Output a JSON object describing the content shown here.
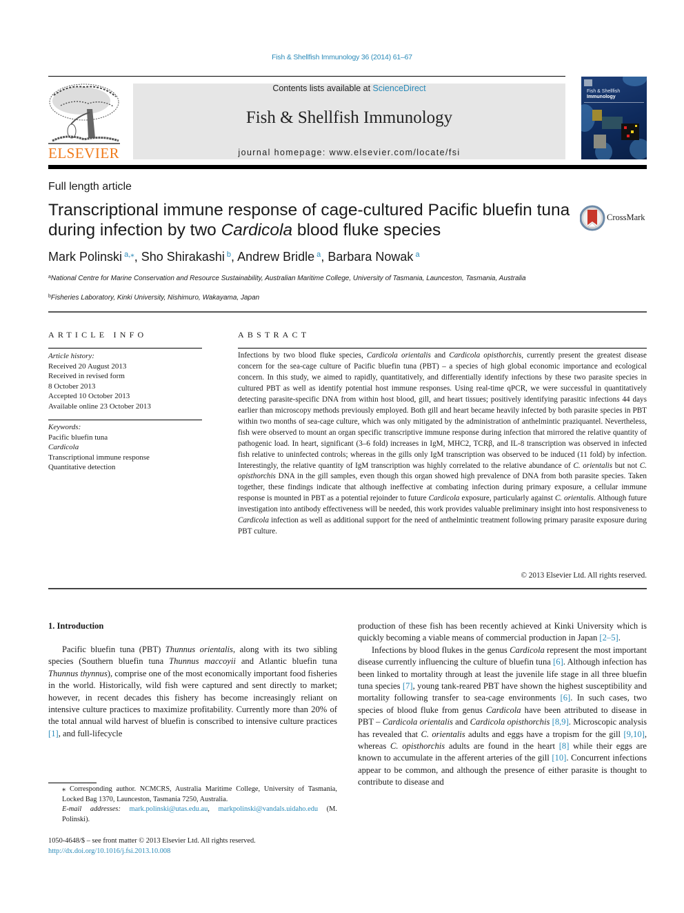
{
  "running_head": "Fish & Shellfish Immunology 36 (2014) 61–67",
  "header": {
    "publisher_logo_text": "ELSEVIER",
    "contents_prefix": "Contents lists available at ",
    "contents_link": "ScienceDirect",
    "journal_title": "Fish & Shellfish Immunology",
    "homepage": "journal homepage: www.elsevier.com/locate/fsi",
    "cover_title_line1": "Fish & Shellfish",
    "cover_title_line2": "Immunology"
  },
  "article": {
    "type": "Full length article",
    "title_part1": "Transcriptional immune response of cage-cultured Pacific bluefin tuna during infection by two ",
    "title_italic": "Cardicola",
    "title_part2": " blood fluke species",
    "crossmark_label": "CrossMark",
    "authors": [
      {
        "name": "Mark Polinski",
        "sup": "a,⁎"
      },
      {
        "name": "Sho Shirakashi",
        "sup": "b"
      },
      {
        "name": "Andrew Bridle",
        "sup": "a"
      },
      {
        "name": "Barbara Nowak",
        "sup": "a"
      }
    ],
    "affiliations": [
      {
        "label": "a",
        "text": "National Centre for Marine Conservation and Resource Sustainability, Australian Maritime College, University of Tasmania, Launceston, Tasmania, Australia"
      },
      {
        "label": "b",
        "text": "Fisheries Laboratory, Kinki University, Nishimuro, Wakayama, Japan"
      }
    ]
  },
  "article_info": {
    "heading": "ARTICLE INFO",
    "history_label": "Article history:",
    "history": [
      "Received 20 August 2013",
      "Received in revised form",
      "8 October 2013",
      "Accepted 10 October 2013",
      "Available online 23 October 2013"
    ],
    "keywords_label": "Keywords:",
    "keywords": [
      "Pacific bluefin tuna",
      "Cardicola",
      "Transcriptional immune response",
      "Quantitative detection"
    ]
  },
  "abstract": {
    "heading": "ABSTRACT",
    "segments": [
      {
        "t": "Infections by two blood fluke species, "
      },
      {
        "t": "Cardicola orientalis",
        "i": true
      },
      {
        "t": " and "
      },
      {
        "t": "Cardicola opisthorchis",
        "i": true
      },
      {
        "t": ", currently present the greatest disease concern for the sea-cage culture of Pacific bluefin tuna (PBT) – a species of high global economic importance and ecological concern. In this study, we aimed to rapidly, quantitatively, and differentially identify infections by these two parasite species in cultured PBT as well as identify potential host immune responses. Using real-time qPCR, we were successful in quantitatively detecting parasite-specific DNA from within host blood, gill, and heart tissues; positively identifying parasitic infections 44 days earlier than microscopy methods previously employed. Both gill and heart became heavily infected by both parasite species in PBT within two months of sea-cage culture, which was only mitigated by the administration of anthelmintic praziquantel. Nevertheless, fish were observed to mount an organ specific transcriptive immune response during infection that mirrored the relative quantity of pathogenic load. In heart, significant (3–6 fold) increases in IgM, MHC2, TCRβ, and IL-8 transcription was observed in infected fish relative to uninfected controls; whereas in the gills only IgM transcription was observed to be induced (11 fold) by infection. Interestingly, the relative quantity of IgM transcription was highly correlated to the relative abundance of "
      },
      {
        "t": "C. orientalis",
        "i": true
      },
      {
        "t": " but not "
      },
      {
        "t": "C. opisthorchis",
        "i": true
      },
      {
        "t": " DNA in the gill samples, even though this organ showed high prevalence of DNA from both parasite species. Taken together, these findings indicate that although ineffective at combating infection during primary exposure, a cellular immune response is mounted in PBT as a potential rejoinder to future "
      },
      {
        "t": "Cardicola",
        "i": true
      },
      {
        "t": " exposure, particularly against "
      },
      {
        "t": "C. orientalis",
        "i": true
      },
      {
        "t": ". Although future investigation into antibody effectiveness will be needed, this work provides valuable preliminary insight into host responsiveness to "
      },
      {
        "t": "Cardicola",
        "i": true
      },
      {
        "t": " infection as well as additional support for the need of anthelmintic treatment following primary parasite exposure during PBT culture."
      }
    ],
    "copyright": "© 2013 Elsevier Ltd. All rights reserved."
  },
  "introduction": {
    "heading": "1.  Introduction",
    "left_segments": [
      {
        "t": "Pacific bluefin tuna (PBT) "
      },
      {
        "t": "Thunnus orientalis",
        "i": true
      },
      {
        "t": ", along with its two sibling species (Southern bluefin tuna "
      },
      {
        "t": "Thunnus maccoyii",
        "i": true
      },
      {
        "t": " and Atlantic bluefin tuna "
      },
      {
        "t": "Thunnus thynnus",
        "i": true
      },
      {
        "t": "), comprise one of the most economically important food fisheries in the world. Historically, wild fish were captured and sent directly to market; however, in recent decades this fishery has become increasingly reliant on intensive culture practices to maximize profitability. Currently more than 20% of the total annual wild harvest of bluefin is conscribed to intensive culture practices "
      },
      {
        "t": "[1]",
        "l": true
      },
      {
        "t": ", and full-lifecycle"
      }
    ],
    "right_p1_segments": [
      {
        "t": "production of these fish has been recently achieved at Kinki University which is quickly becoming a viable means of commercial production in Japan "
      },
      {
        "t": "[2–5]",
        "l": true
      },
      {
        "t": "."
      }
    ],
    "right_p2_segments": [
      {
        "t": "Infections by blood flukes in the genus "
      },
      {
        "t": "Cardicola",
        "i": true
      },
      {
        "t": " represent the most important disease currently influencing the culture of bluefin tuna "
      },
      {
        "t": "[6]",
        "l": true
      },
      {
        "t": ". Although infection has been linked to mortality through at least the juvenile life stage in all three bluefin tuna species "
      },
      {
        "t": "[7]",
        "l": true
      },
      {
        "t": ", young tank-reared PBT have shown the highest susceptibility and mortality following transfer to sea-cage environments "
      },
      {
        "t": "[6]",
        "l": true
      },
      {
        "t": ". In such cases, two species of blood fluke from genus "
      },
      {
        "t": "Cardicola",
        "i": true
      },
      {
        "t": " have been attributed to disease in PBT – "
      },
      {
        "t": "Cardicola orientalis",
        "i": true
      },
      {
        "t": " and "
      },
      {
        "t": "Cardicola opisthorchis",
        "i": true
      },
      {
        "t": " "
      },
      {
        "t": "[8,9]",
        "l": true
      },
      {
        "t": ". Microscopic analysis has revealed that "
      },
      {
        "t": "C. orientalis",
        "i": true
      },
      {
        "t": " adults and eggs have a tropism for the gill "
      },
      {
        "t": "[9,10]",
        "l": true
      },
      {
        "t": ", whereas "
      },
      {
        "t": "C. opisthorchis",
        "i": true
      },
      {
        "t": " adults are found in the heart "
      },
      {
        "t": "[8]",
        "l": true
      },
      {
        "t": " while their eggs are known to accumulate in the afferent arteries of the gill "
      },
      {
        "t": "[10]",
        "l": true
      },
      {
        "t": ". Concurrent infections appear to be common, and although the presence of either parasite is thought to contribute to disease and"
      }
    ]
  },
  "footnote": {
    "corresponding": "⁎ Corresponding author. NCMCRS, Australia Maritime College, University of Tasmania, Locked Bag 1370, Launceston, Tasmania 7250, Australia.",
    "email_label": "E-mail addresses:",
    "email1": "mark.polinski@utas.edu.au",
    "email2": "markpolinski@vandals.uidaho.edu",
    "email_suffix": " (M. Polinski).",
    "front_matter": "1050-4648/$ – see front matter © 2013 Elsevier Ltd. All rights reserved.",
    "doi": "http://dx.doi.org/10.1016/j.fsi.2013.10.008"
  },
  "colors": {
    "link": "#2a8ab8",
    "elsevier_orange": "#f07a1a",
    "header_gray": "#e6e6e6"
  }
}
